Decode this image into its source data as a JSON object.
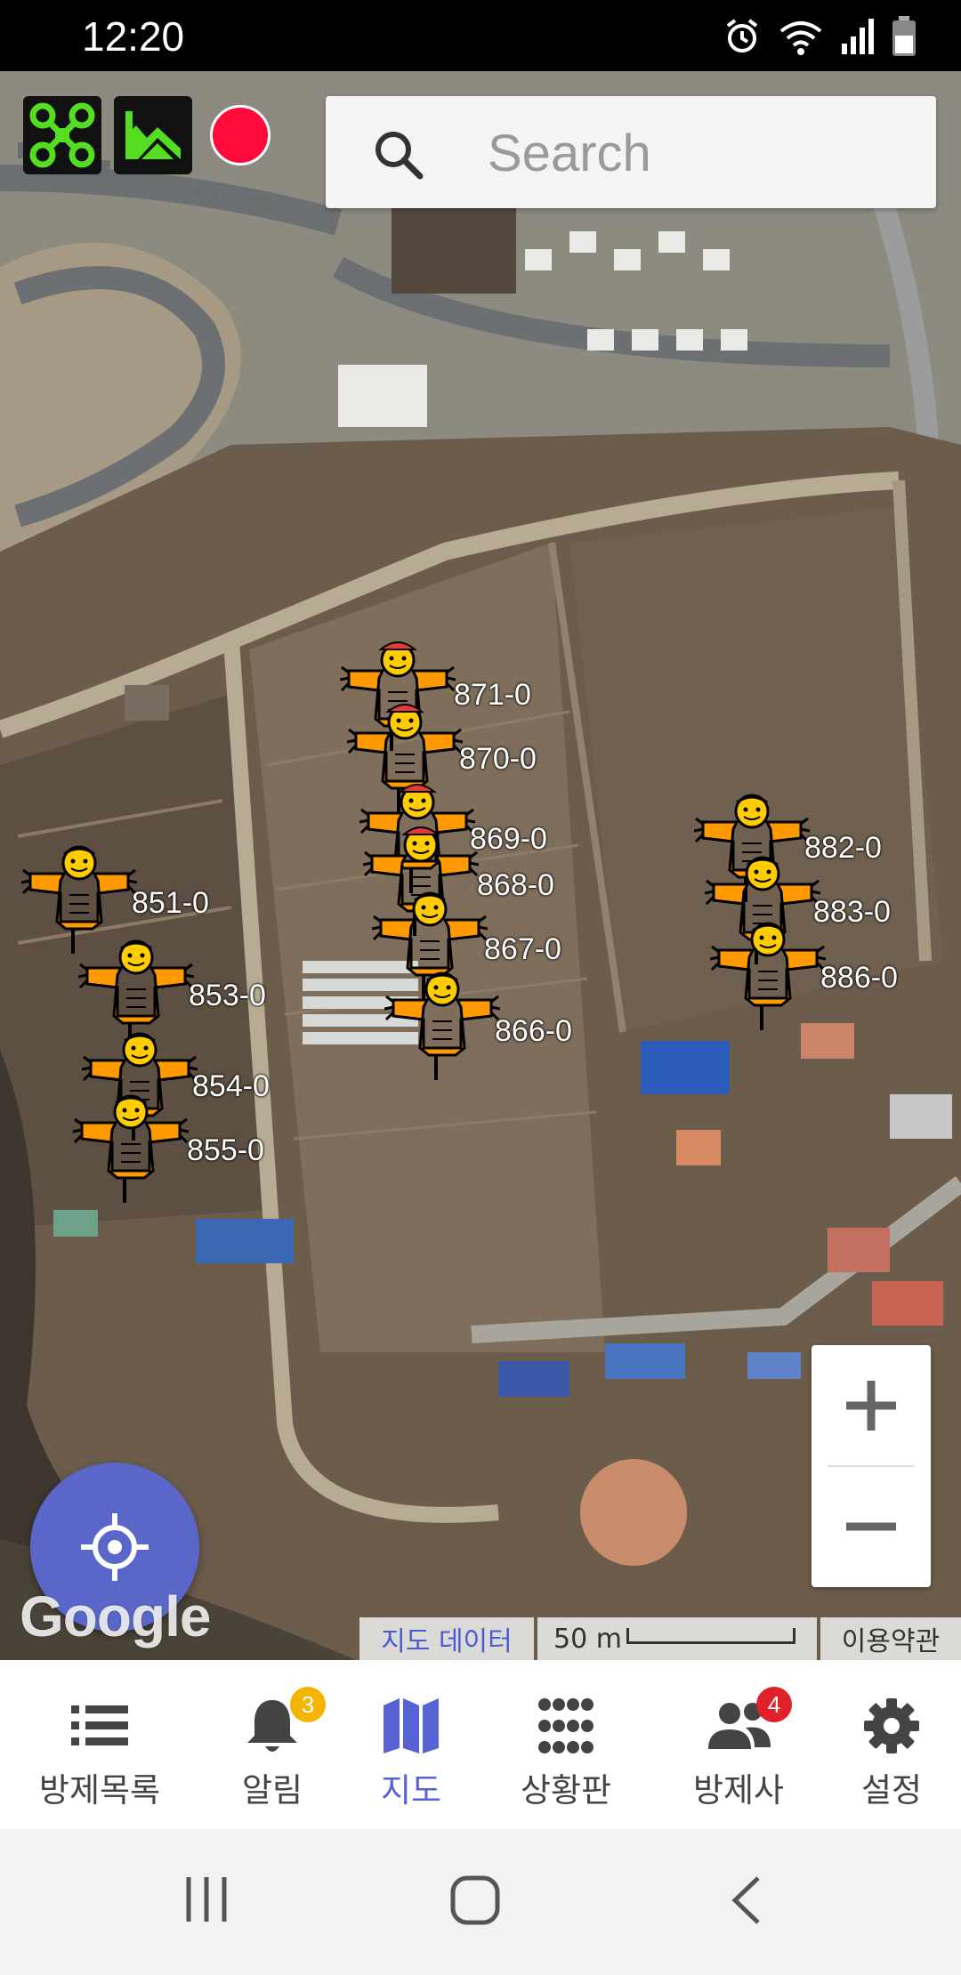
{
  "status_bar": {
    "time": "12:20",
    "icons": [
      "alarm-icon",
      "wifi-icon",
      "signal-icon",
      "battery-icon"
    ]
  },
  "toolbar": {
    "buttons": [
      "drone-icon",
      "terrain-map-icon",
      "record-indicator"
    ]
  },
  "search": {
    "placeholder": "Search"
  },
  "markers": [
    {
      "id": "871-0"
    },
    {
      "id": "870-0"
    },
    {
      "id": "869-0"
    },
    {
      "id": "868-0"
    },
    {
      "id": "867-0"
    },
    {
      "id": "866-0"
    },
    {
      "id": "851-0"
    },
    {
      "id": "853-0"
    },
    {
      "id": "854-0"
    },
    {
      "id": "855-0"
    },
    {
      "id": "882-0"
    },
    {
      "id": "883-0"
    },
    {
      "id": "886-0"
    }
  ],
  "map": {
    "attribution_map_data": "지도 데이터",
    "scale_label": "50 m",
    "terms": "이용약관",
    "google_logo": "Google"
  },
  "bottom_nav": {
    "items": [
      {
        "label": "방제목록",
        "icon": "list-icon"
      },
      {
        "label": "알림",
        "icon": "bell-icon",
        "badge": "3"
      },
      {
        "label": "지도",
        "icon": "map-icon",
        "active": true
      },
      {
        "label": "상황판",
        "icon": "grid-dots-icon"
      },
      {
        "label": "방제사",
        "icon": "people-icon",
        "badge": "4"
      },
      {
        "label": "설정",
        "icon": "gear-icon"
      }
    ]
  },
  "colors": {
    "accent": "#5762d5",
    "fab": "#5b67c8",
    "marker": "#ff9900",
    "record": "#ff0a3a",
    "badge_yellow": "#f5b400",
    "badge_red": "#e0202a",
    "drone_green": "#55dd22"
  }
}
